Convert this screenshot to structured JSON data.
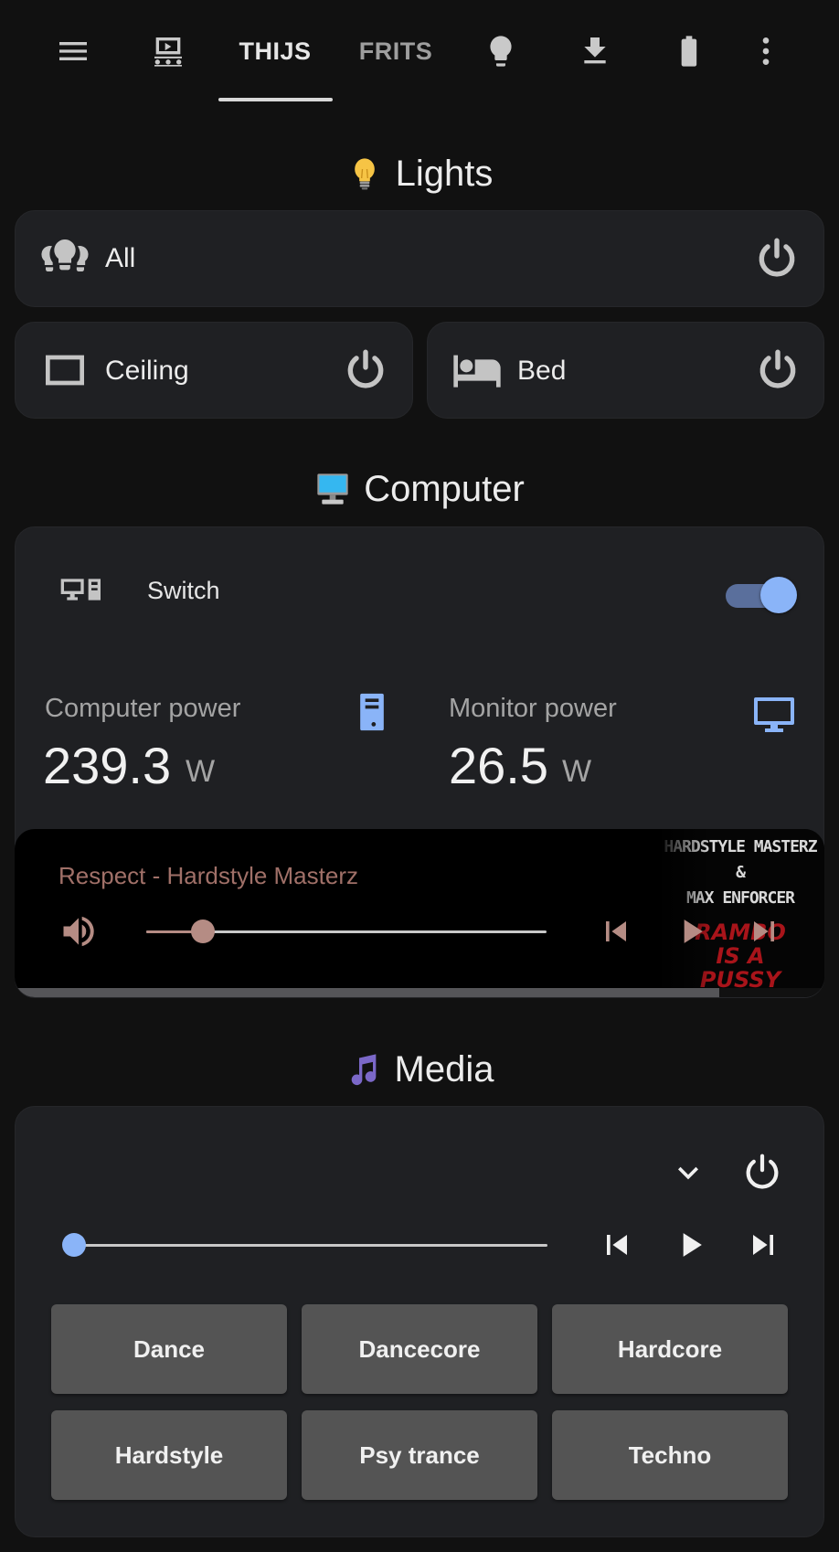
{
  "tabs": [
    {
      "label": "THIJS",
      "active": true
    },
    {
      "label": "FRITS",
      "active": false
    }
  ],
  "topbar_icons": [
    "menu-icon",
    "theater-icon",
    "lightbulb-icon",
    "download-icon",
    "battery-icon",
    "more-vert-icon"
  ],
  "lights": {
    "title": "Lights",
    "all_label": "All",
    "ceiling_label": "Ceiling",
    "bed_label": "Bed"
  },
  "computer": {
    "title": "Computer",
    "switch_label": "Switch",
    "switch_on": true,
    "computer_power_label": "Computer power",
    "computer_power_value": "239.3",
    "computer_power_unit": "W",
    "monitor_power_label": "Monitor power",
    "monitor_power_value": "26.5",
    "monitor_power_unit": "W",
    "now_playing": "Respect - Hardstyle Masterz",
    "volume_level": 0.14,
    "track_progress": 0.87,
    "album_art_text_top": "HARDSTYLE MASTERZ\n&\nMAX ENFORCER",
    "album_art_text_bottom": "RAMBO\nIS A\nPUSSY"
  },
  "media": {
    "title": "Media",
    "volume_level": 0.0,
    "presets": [
      "Dance",
      "Dancecore",
      "Hardcore",
      "Hardstyle",
      "Psy trance",
      "Techno"
    ]
  },
  "colors": {
    "background": "#111111",
    "card": "#1f2023",
    "accent": "#8ab4f8",
    "mini_player_accent": "#b58c84",
    "preset_button": "#545454"
  }
}
